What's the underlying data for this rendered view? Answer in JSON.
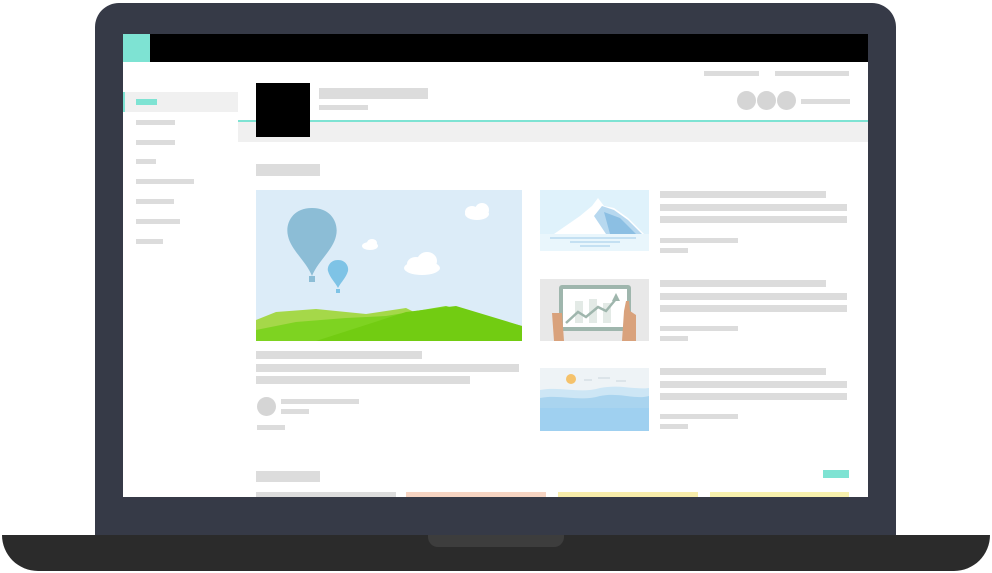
{
  "device": "laptop",
  "colors": {
    "accent": "#7ee3d3",
    "bezel": "#363a47",
    "placeholder_bar": "#dcdcdc",
    "sky": "#dcecf8",
    "grass": "#7ed321",
    "water": "#9fd0f0"
  },
  "window": {
    "title": ""
  },
  "sidebar": {
    "items": 8,
    "active_index": 0
  },
  "header": {
    "avatar": "black-square",
    "status_dots": 3
  },
  "section_1": {
    "featured": "hot-air-balloons-landscape",
    "side_cards": [
      "iceberg",
      "tablet-chart",
      "sunset-sea"
    ]
  },
  "section_2": {
    "category_colors": [
      "#dcdcdc",
      "#f6d4c2",
      "#f7ecaa",
      "#f7f0ad"
    ]
  }
}
